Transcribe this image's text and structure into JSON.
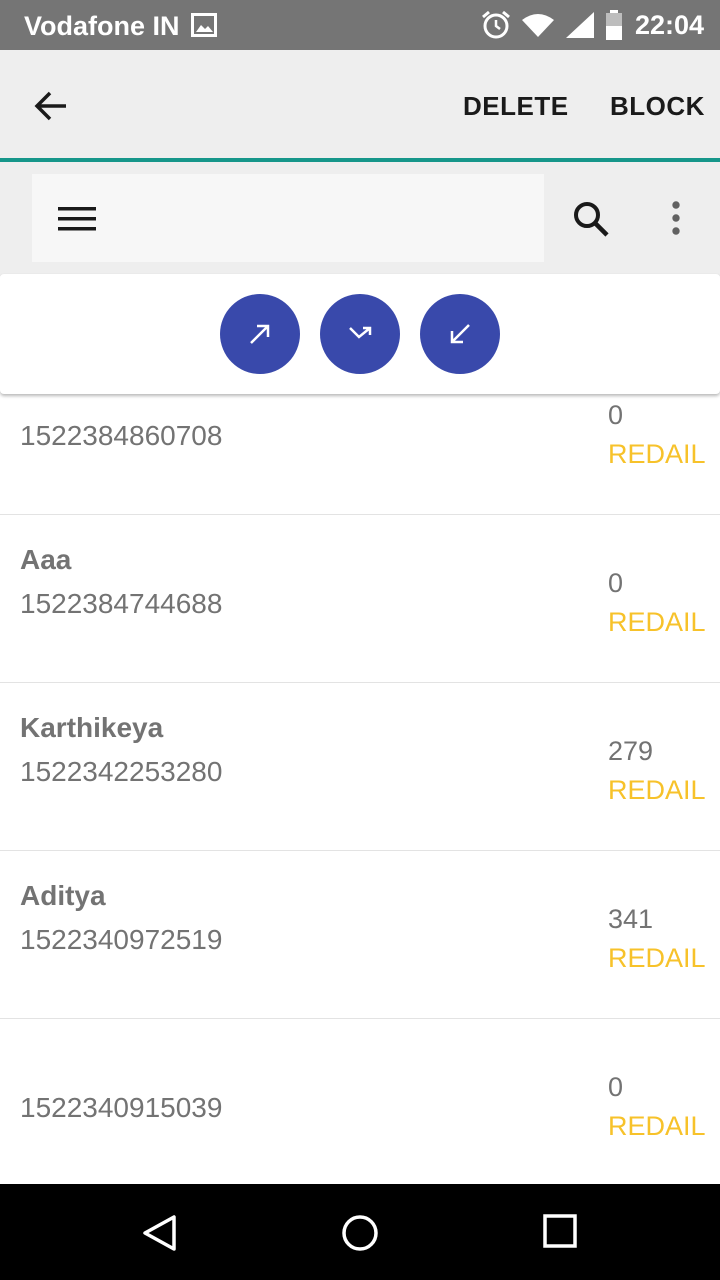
{
  "status_bar": {
    "carrier": "Vodafone IN",
    "time": "22:04",
    "icons": [
      "image-icon",
      "alarm-icon",
      "wifi-icon",
      "signal-icon",
      "battery-icon"
    ]
  },
  "action_bar": {
    "back_icon": "arrow-left-icon",
    "delete_label": "DELETE",
    "block_label": "BLOCK",
    "accent_color": "#16968a"
  },
  "toolbar": {
    "menu_icon": "hamburger-menu-icon",
    "search_icon": "search-icon",
    "more_icon": "more-vertical-icon"
  },
  "filters": {
    "color": "#3949ab",
    "buttons": [
      {
        "icon": "outgoing-call-icon"
      },
      {
        "icon": "missed-call-icon"
      },
      {
        "icon": "incoming-call-icon"
      }
    ]
  },
  "calls": [
    {
      "name": "",
      "number": "1522384860708",
      "duration": "0",
      "action": "REDAIL"
    },
    {
      "name": "Aaa",
      "number": "1522384744688",
      "duration": "0",
      "action": "REDAIL"
    },
    {
      "name": "Karthikeya",
      "number": "1522342253280",
      "duration": "279",
      "action": "REDAIL"
    },
    {
      "name": "Aditya",
      "number": "1522340972519",
      "duration": "341",
      "action": "REDAIL"
    },
    {
      "name": "",
      "number": "1522340915039",
      "duration": "0",
      "action": "REDAIL"
    }
  ],
  "nav_bar": {
    "icons": [
      "back-triangle-icon",
      "home-circle-icon",
      "recents-square-icon"
    ]
  }
}
